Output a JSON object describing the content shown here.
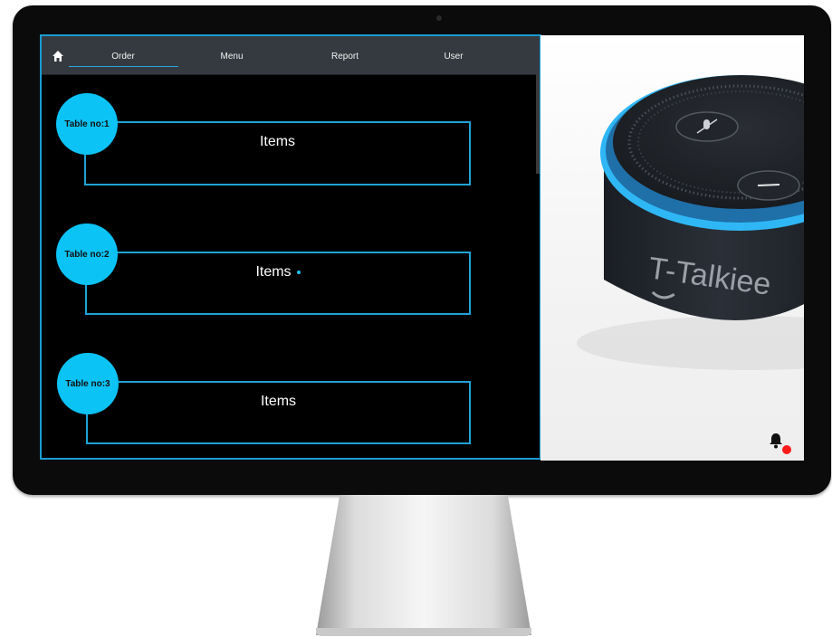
{
  "nav": {
    "items": [
      {
        "label": "Order"
      },
      {
        "label": "Menu"
      },
      {
        "label": "Report"
      },
      {
        "label": "User"
      }
    ]
  },
  "tables": [
    {
      "label": "Table no:1",
      "items_label": "Items"
    },
    {
      "label": "Table no:2",
      "items_label": "Items"
    },
    {
      "label": "Table no:3",
      "items_label": "Items"
    }
  ],
  "device": {
    "brand_text": "T-Talkiee"
  },
  "colors": {
    "accent": "#0cc3f5",
    "navbar": "#343a40",
    "badge": "#ff1a1a"
  },
  "icons": [
    "home-icon",
    "bell-icon",
    "mic-off-icon",
    "minus-icon"
  ]
}
